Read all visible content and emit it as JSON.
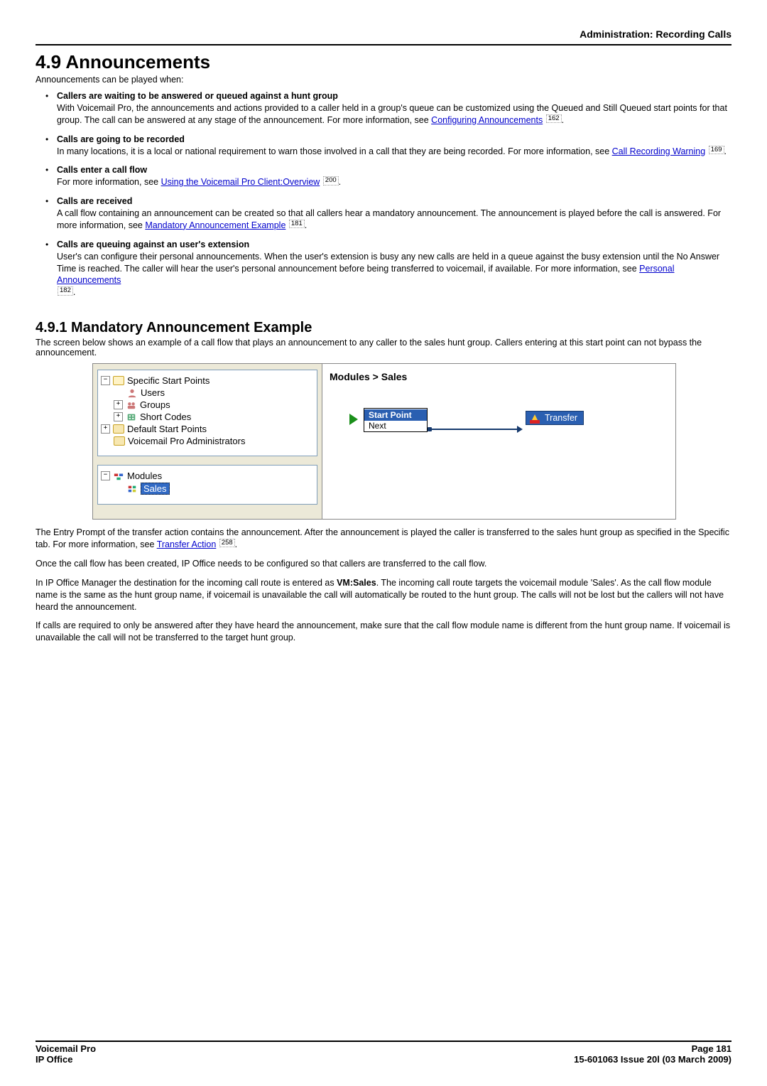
{
  "header": {
    "right": "Administration: Recording Calls"
  },
  "section": {
    "title": "4.9 Announcements",
    "intro": "Announcements can be played when:"
  },
  "bullets": [
    {
      "title": "Callers are waiting to be answered or queued against a hunt group",
      "pre": "With Voicemail Pro, the announcements and actions provided to a caller held in a group's queue can be customized using the Queued and Still Queued start points for that group. The call can be answered at any stage of the announcement. For more information, see ",
      "link": "Configuring Announcements",
      "ref": "162",
      "post": "."
    },
    {
      "title": "Calls are going to be recorded",
      "pre": "In many locations, it is a local or national requirement to warn those involved in a call that they are being recorded. For more information, see ",
      "link": "Call Recording Warning",
      "ref": "169",
      "post": "."
    },
    {
      "title": "Calls enter a call flow",
      "pre": "For more information, see ",
      "link": "Using the Voicemail Pro Client:Overview",
      "ref": "200",
      "post": "."
    },
    {
      "title": "Calls are received",
      "pre": "A call flow containing an announcement can be created so that all callers hear a mandatory announcement. The announcement is played before the call is answered. For more information, see ",
      "link": "Mandatory Announcement Example",
      "ref": "181",
      "post": "."
    },
    {
      "title": "Calls are queuing against an user's extension",
      "pre": "User's can configure their personal announcements. When the user's extension is busy any new calls are held in a queue against the busy extension until the No Answer Time is reached. The caller will hear the user's personal announcement before being transferred to voicemail, if available. For more information, see ",
      "link": "Personal Announcements",
      "ref": "182",
      "post": "."
    }
  ],
  "subsection": {
    "title": "4.9.1 Mandatory Announcement Example",
    "lead": "The screen below shows an example of a call flow that plays an announcement to any caller to the sales hunt group. Callers entering at this start point can not bypass the announcement."
  },
  "screenshot": {
    "tree": {
      "root": "Specific Start Points",
      "items": [
        "Users",
        "Groups",
        "Short Codes",
        "Default Start Points",
        "Voicemail Pro Administrators"
      ],
      "modules_root": "Modules",
      "module_item": "Sales"
    },
    "breadcrumb": "Modules > Sales",
    "start_point": {
      "title": "Start Point",
      "port": "Next"
    },
    "transfer_label": "Transfer"
  },
  "paras": {
    "p1_pre": "The Entry Prompt of the transfer action contains the announcement. After the announcement is played the caller is transferred to the sales hunt group as specified in the Specific tab. For more information, see ",
    "p1_link": "Transfer Action",
    "p1_ref": "258",
    "p1_post": ".",
    "p2": "Once the call flow has been created, IP Office needs to be configured so that callers are transferred to the call flow.",
    "p3_a": "In IP Office Manager the destination for the incoming call route is entered as ",
    "p3_bold": "VM:Sales",
    "p3_b": ". The incoming call route targets the voicemail module 'Sales'. As the call flow module name is the same as the hunt group name, if voicemail is unavailable the call will automatically be routed to the hunt group. The calls will not be lost but the callers will not have heard the announcement.",
    "p4": "If calls are required to only be answered after they have heard the announcement, make sure that the call flow module name is different from the hunt group name. If voicemail is unavailable the call will not be transferred to the target hunt group."
  },
  "footer": {
    "left1": "Voicemail Pro",
    "left2": "IP Office",
    "right1": "Page 181",
    "right2": "15-601063 Issue 20l (03 March 2009)"
  }
}
